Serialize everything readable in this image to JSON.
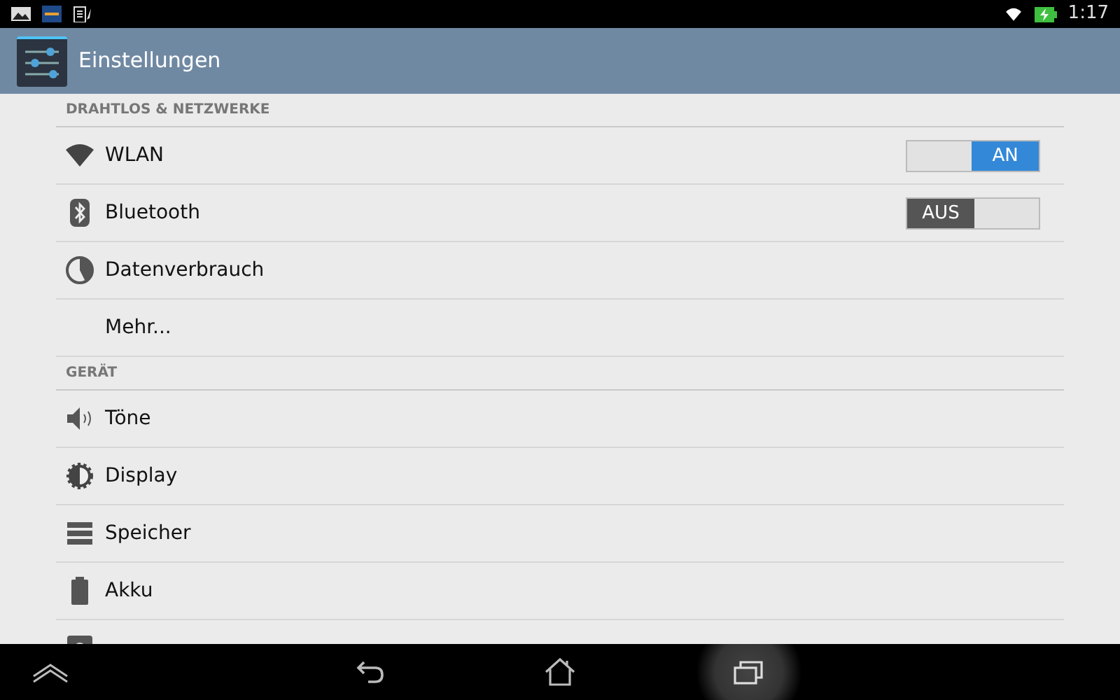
{
  "status_bar": {
    "time": "1:17",
    "battery_charging": true
  },
  "action_bar": {
    "title": "Einstellungen"
  },
  "sections": [
    {
      "header": "DRAHTLOS & NETZWERKE",
      "items": [
        {
          "label": "WLAN",
          "kind": "switch",
          "on": true,
          "switch_text": "AN"
        },
        {
          "label": "Bluetooth",
          "kind": "switch",
          "on": false,
          "switch_text": "AUS"
        },
        {
          "label": "Datenverbrauch",
          "kind": "plain"
        },
        {
          "label": "Mehr...",
          "kind": "plain"
        }
      ]
    },
    {
      "header": "GERÄT",
      "items": [
        {
          "label": "Töne",
          "kind": "plain"
        },
        {
          "label": "Display",
          "kind": "plain"
        },
        {
          "label": "Speicher",
          "kind": "plain"
        },
        {
          "label": "Akku",
          "kind": "plain"
        },
        {
          "kind": "partial"
        }
      ]
    }
  ],
  "nav_bar": [
    {
      "pressed": false
    },
    {
      "pressed": false
    },
    {
      "pressed": false
    },
    {
      "pressed": true
    }
  ]
}
